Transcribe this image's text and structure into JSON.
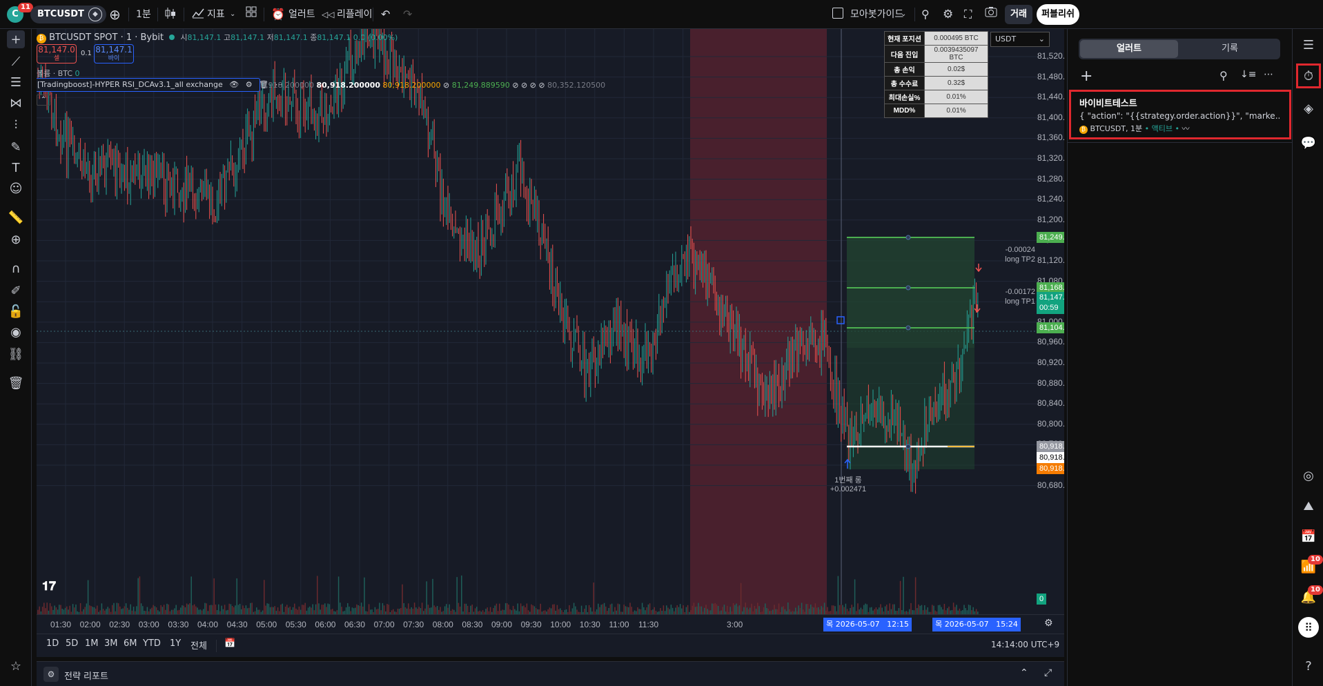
{
  "topbar": {
    "avatar_letter": "C",
    "avatar_badge": "11",
    "symbol": "BTCUSDT",
    "interval": "1분",
    "indicators": "지표",
    "alerts": "얼러트",
    "replay": "리플레이",
    "guide": "모아봇가이드",
    "trade_btn": "거래",
    "publish_btn": "퍼블리쉬"
  },
  "legend": {
    "title": "BTCUSDT SPOT · 1 · Bybit",
    "o_label": "시",
    "o": "81,147.1",
    "h_label": "고",
    "h": "81,147.1",
    "l_label": "저",
    "l": "81,147.1",
    "c_label": "종",
    "c": "81,147.1",
    "chg": "0.0 (0.00%)",
    "sell_price": "81,147.0",
    "sell_label": "셀",
    "spread": "0.1",
    "buy_price": "81,147.1",
    "buy_label": "바이",
    "volume_label": "볼륨 · BTC",
    "volume_value": "0",
    "indicator_name": "[Tradingboost]-HYPER RSI_DCAv3.1_all exchange",
    "ind_v1": "0,918.200000",
    "ind_v2": "80,918.200000",
    "ind_v3": "80,918.200000",
    "ind_v4": "81,249.889590",
    "ind_v5": "80,352.120500"
  },
  "stats": [
    {
      "k": "현재 포지션",
      "v": "0.000495 BTC"
    },
    {
      "k": "다음 진입",
      "v": "0.0039435097 BTC"
    },
    {
      "k": "총 손익",
      "v": "0.02$"
    },
    {
      "k": "총 수수료",
      "v": "0.32$"
    },
    {
      "k": "최대손실%",
      "v": "0.01%"
    },
    {
      "k": "MDD%",
      "v": "0.01%"
    }
  ],
  "currency": "USDT",
  "price_axis": [
    "81,520.0",
    "81,480.0",
    "81,440.0",
    "81,400.0",
    "81,360.0",
    "81,320.0",
    "81,280.0",
    "81,240.0",
    "81,200.0",
    "81,160.0",
    "81,120.0",
    "81,080.0",
    "81,040.0",
    "81,000.0",
    "80,960.0",
    "80,920.0",
    "80,880.0",
    "80,840.0",
    "80,800.0",
    "80,760.0",
    "80,720.0",
    "80,680.0"
  ],
  "price_tags": {
    "tp2": "81,249.889590",
    "tp1": "81,168.989690",
    "last": "81,147.1",
    "countdown": "00:59",
    "entry_tp": "81,104.269770",
    "avg1": "80,918.200000",
    "avg2": "80,918.200000",
    "avg3": "80,918.200000",
    "vol": "0"
  },
  "annotations": {
    "tp2_pnl": "-0.00024",
    "tp2_label": "long TP2",
    "tp1_pnl": "-0.00172",
    "tp1_label": "long TP1",
    "entry_label": "1번째 롱",
    "entry_pnl": "+0.002471"
  },
  "time_axis": [
    "01:30",
    "02:00",
    "02:30",
    "03:00",
    "03:30",
    "04:00",
    "04:30",
    "05:00",
    "05:30",
    "06:00",
    "06:30",
    "07:00",
    "07:30",
    "08:00",
    "08:30",
    "09:00",
    "09:30",
    "10:00",
    "10:30",
    "11:00",
    "11:30",
    "3:00"
  ],
  "time_tags": {
    "t1": "목 2026-05-07   12:15",
    "t2": "목 2026-05-07   15:24"
  },
  "ranges": [
    "1D",
    "5D",
    "1M",
    "3M",
    "6M",
    "YTD",
    "1Y",
    "전체"
  ],
  "clock": "14:14:00 UTC+9",
  "strategy_report": "전략 리포트",
  "alerts_panel": {
    "tab_alerts": "얼러트",
    "tab_log": "기록",
    "alert_name": "바이비트테스트",
    "alert_msg": "{ \"action\": \"{{strategy.order.action}}\", \"marke...",
    "alert_symbol": "BTCUSDT, 1분",
    "alert_status": "액티브"
  },
  "rightbar_badges": {
    "feed": "10",
    "notif": "10"
  },
  "colors": {
    "up": "#26a69a",
    "down": "#ef5350",
    "panel": "#171b26",
    "highlight": "#e0282e",
    "tp_green": "#4caf50",
    "accent": "#2962ff"
  }
}
